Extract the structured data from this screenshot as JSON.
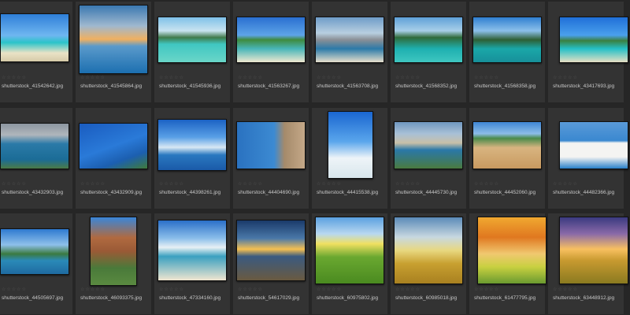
{
  "thumbnails": [
    {
      "file": "shutterstock_41542642.jpg",
      "rating": "☆☆☆☆☆"
    },
    {
      "file": "shutterstock_41545864.jpg",
      "rating": "☆☆☆☆☆"
    },
    {
      "file": "shutterstock_41545936.jpg",
      "rating": "☆☆☆☆☆"
    },
    {
      "file": "shutterstock_41563267.jpg",
      "rating": "☆☆☆☆☆"
    },
    {
      "file": "shutterstock_41563708.jpg",
      "rating": "☆☆☆☆☆"
    },
    {
      "file": "shutterstock_41568352.jpg",
      "rating": "☆☆☆☆☆"
    },
    {
      "file": "shutterstock_41568358.jpg",
      "rating": "☆☆☆☆☆"
    },
    {
      "file": "shutterstock_43417693.jpg",
      "rating": "☆☆☆☆☆"
    },
    {
      "file": "shutterstock_43432903.jpg",
      "rating": "☆☆☆☆☆"
    },
    {
      "file": "shutterstock_43432909.jpg",
      "rating": "☆☆☆☆☆"
    },
    {
      "file": "shutterstock_44398261.jpg",
      "rating": "☆☆☆☆☆"
    },
    {
      "file": "shutterstock_44404690.jpg",
      "rating": "☆☆☆☆☆"
    },
    {
      "file": "shutterstock_44415538.jpg",
      "rating": "☆☆☆☆☆"
    },
    {
      "file": "shutterstock_44445730.jpg",
      "rating": "☆☆☆☆☆"
    },
    {
      "file": "shutterstock_44452060.jpg",
      "rating": "☆☆☆☆☆"
    },
    {
      "file": "shutterstock_44482366.jpg",
      "rating": "☆☆☆☆☆"
    },
    {
      "file": "shutterstock_44505697.jpg",
      "rating": "☆☆☆☆☆"
    },
    {
      "file": "shutterstock_46093375.jpg",
      "rating": "☆☆☆☆☆"
    },
    {
      "file": "shutterstock_47334160.jpg",
      "rating": "☆☆☆☆☆"
    },
    {
      "file": "shutterstock_54617029.jpg",
      "rating": "☆☆☆☆☆"
    },
    {
      "file": "shutterstock_60975802.jpg",
      "rating": "☆☆☆☆☆"
    },
    {
      "file": "shutterstock_60985018.jpg",
      "rating": "☆☆☆☆☆"
    },
    {
      "file": "shutterstock_61477795.jpg",
      "rating": "☆☆☆☆☆"
    },
    {
      "file": "shutterstock_63448912.jpg",
      "rating": "☆☆☆☆☆"
    }
  ]
}
